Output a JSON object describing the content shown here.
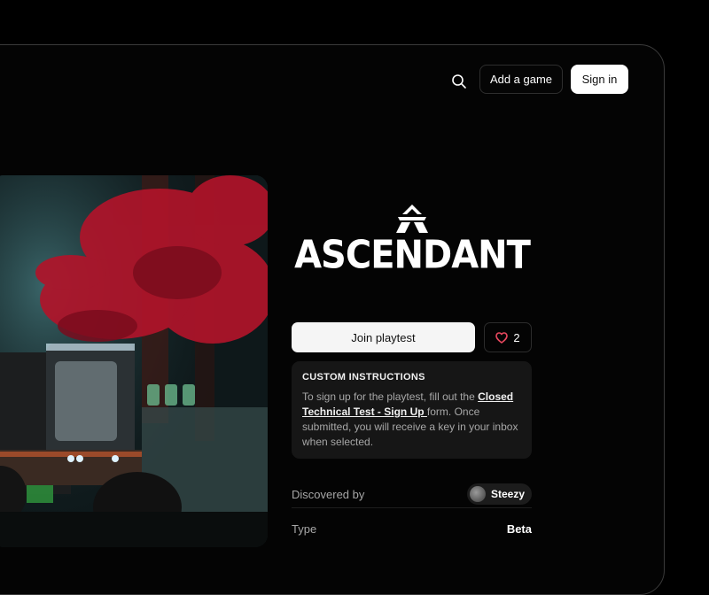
{
  "header": {
    "add_game_label": "Add a game",
    "sign_in_label": "Sign in"
  },
  "game": {
    "logo_text": "ASCENDANT",
    "join_label": "Join playtest",
    "like_count": "2"
  },
  "instructions": {
    "title": "CUSTOM INSTRUCTIONS",
    "text_before": "To sign up for the playtest, fill out the ",
    "link": "Closed Technical Test - Sign Up ",
    "text_after": "form. Once submitted, you will receive a key in your inbox when selected."
  },
  "details": {
    "discovered_label": "Discovered by",
    "discoverer": "Steezy",
    "type_label": "Type",
    "type_value": "Beta"
  },
  "colors": {
    "accent_heart": "#e8485f",
    "background": "#000000"
  }
}
